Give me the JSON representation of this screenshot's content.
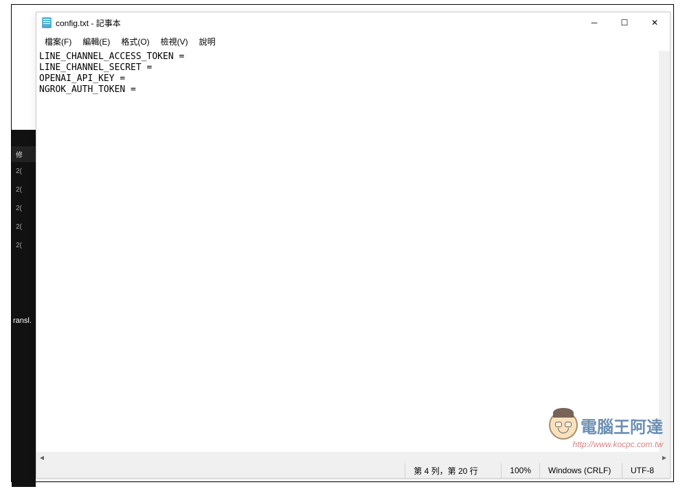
{
  "background": {
    "sidebar_label": "ransl.",
    "header_label": "修",
    "items": [
      "2(",
      "2(",
      "2(",
      "2(",
      "2("
    ]
  },
  "window": {
    "title": "config.txt - 記事本",
    "controls": {
      "minimize": "─",
      "maximize": "☐",
      "close": "✕"
    }
  },
  "menu": {
    "items": [
      "檔案(F)",
      "編輯(E)",
      "格式(O)",
      "檢視(V)",
      "說明"
    ]
  },
  "content": {
    "lines": [
      "LINE_CHANNEL_ACCESS_TOKEN = ",
      "LINE_CHANNEL_SECRET = ",
      "OPENAI_API_KEY = ",
      "NGROK_AUTH_TOKEN = "
    ]
  },
  "scrollbar": {
    "left_arrow": "◀",
    "right_arrow": "▶"
  },
  "status_bar": {
    "position": "第 4 列，第 20 行",
    "zoom": "100%",
    "line_ending": "Windows (CRLF)",
    "encoding": "UTF-8"
  },
  "watermark": {
    "text": "電腦王阿達",
    "url": "http://www.kocpc.com.tw"
  }
}
